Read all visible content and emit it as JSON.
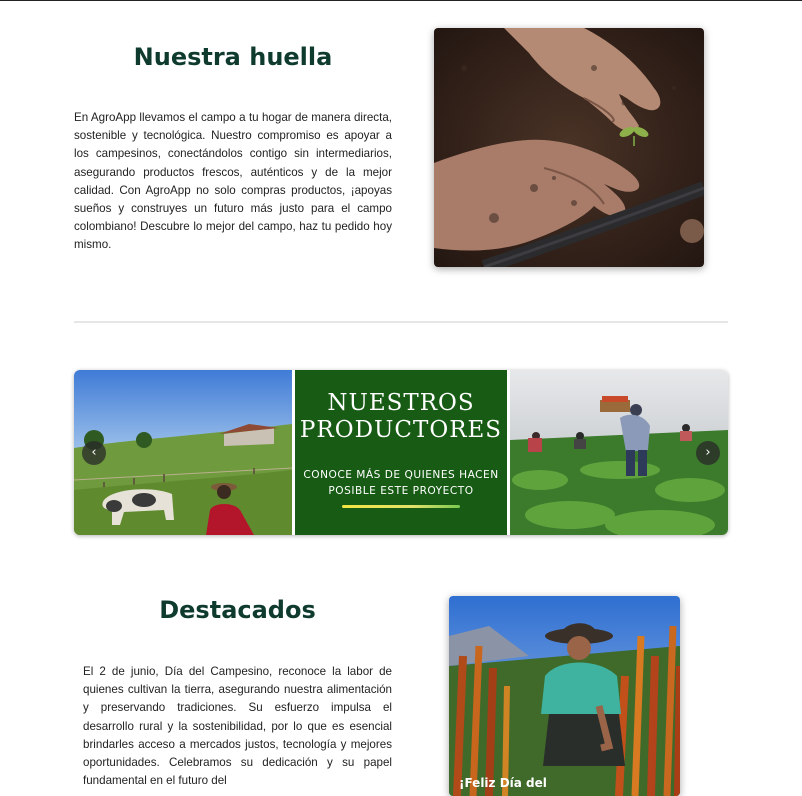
{
  "huella": {
    "title": "Nuestra huella",
    "text": "En AgroApp llevamos el campo a tu hogar de manera directa, sostenible y tecnológica. Nuestro compromiso es apoyar a los campesinos, conectándolos contigo sin intermediarios, asegurando productos frescos, auténticos y de la mejor calidad. Con AgroApp no solo compras productos, ¡apoyas sueños y construyes un futuro más justo para el campo colombiano! Descubre lo mejor del campo, haz tu pedido hoy mismo."
  },
  "carousel": {
    "promo_title_line1": "NUESTROS",
    "promo_title_line2": "PRODUCTORES",
    "promo_sub_line1": "CONOCE MÁS DE QUIENES HACEN",
    "promo_sub_line2": "POSIBLE  ESTE PROYECTO",
    "prev_icon": "‹",
    "next_icon": "›",
    "colors": {
      "promo_bg": "#175b14"
    }
  },
  "destacados": {
    "title": "Destacados",
    "text": "El 2 de junio, Día del Campesino, reconoce la labor de quienes cultivan la tierra, asegurando nuestra alimentación y preservando tradiciones. Su esfuerzo impulsa el desarrollo rural y la sostenibilidad, por lo que es esencial brindarles acceso a mercados justos, tecnología y mejores oportunidades. Celebramos su dedicación y su papel fundamental en el futuro del",
    "caption": "¡Feliz Día del"
  },
  "colors": {
    "heading": "#0f3b2e",
    "text": "#222222"
  }
}
